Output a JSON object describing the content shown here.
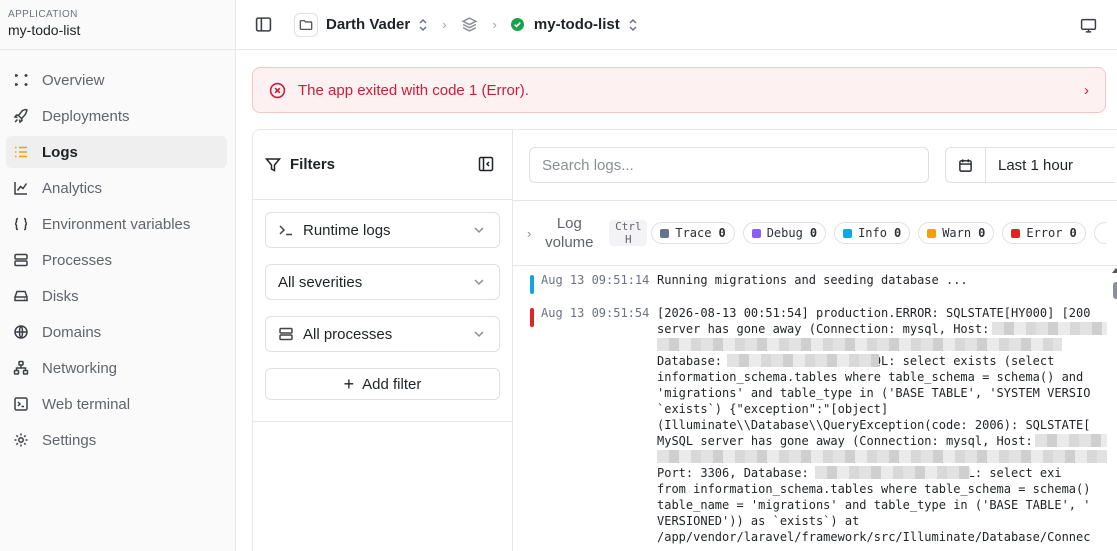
{
  "app": {
    "label": "APPLICATION",
    "name": "my-todo-list"
  },
  "nav": [
    {
      "label": "Overview",
      "icon": "eye-icon"
    },
    {
      "label": "Deployments",
      "icon": "rocket-icon"
    },
    {
      "label": "Logs",
      "icon": "list-icon",
      "active": true
    },
    {
      "label": "Analytics",
      "icon": "chart-line-icon"
    },
    {
      "label": "Environment variables",
      "icon": "braces-icon"
    },
    {
      "label": "Processes",
      "icon": "server-icon"
    },
    {
      "label": "Disks",
      "icon": "hard-drive-icon"
    },
    {
      "label": "Domains",
      "icon": "globe-icon"
    },
    {
      "label": "Networking",
      "icon": "network-icon"
    },
    {
      "label": "Web terminal",
      "icon": "terminal-icon"
    },
    {
      "label": "Settings",
      "icon": "gear-icon"
    }
  ],
  "breadcrumb": {
    "org": "Darth Vader",
    "app": "my-todo-list"
  },
  "banner": {
    "message": "The app exited with code 1 (Error)."
  },
  "filters": {
    "title": "Filters",
    "runtime": "Runtime logs",
    "severity": "All severities",
    "processes": "All processes",
    "add_filter": "Add filter"
  },
  "search": {
    "placeholder": "Search logs..."
  },
  "time": {
    "label": "Last 1 hour"
  },
  "volume": {
    "title_line1": "Log",
    "title_line2": "volume",
    "kbd_line1": "Ctrl",
    "kbd_line2": "H",
    "levels": [
      {
        "name": "Trace",
        "count": "0",
        "color": "#64748b"
      },
      {
        "name": "Debug",
        "count": "0",
        "color": "#8b5cf6"
      },
      {
        "name": "Info",
        "count": "0",
        "color": "#0ea5e9"
      },
      {
        "name": "Warn",
        "count": "0",
        "color": "#f59e0b"
      },
      {
        "name": "Error",
        "count": "0",
        "color": "#dc2626"
      }
    ]
  },
  "logs": [
    {
      "ts": "Aug 13 09:51:14",
      "color": "#0ea5e9",
      "lines": [
        "Running migrations and seeding database ..."
      ]
    },
    {
      "ts": "Aug 13 09:51:54",
      "color": "#dc2626",
      "lines": [
        "[2026-08-13 00:51:54] production.ERROR: SQLSTATE[HY000] [200",
        "server has gone away (Connection: mysql, Host: ",
        "                                               , P",
        "Database:                  , SQL: select exists (select",
        "information_schema.tables where table_schema = schema() and",
        "'migrations' and table_type in ('BASE TABLE', 'SYSTEM VERSIO",
        "`exists`) {\"exception\":\"[object]",
        "(Illuminate\\\\Database\\\\QueryException(code: 2006): SQLSTATE[",
        "MySQL server has gone away (Connection: mysql, Host: ",
        " ",
        "Port: 3306, Database:                    SQL: select exi",
        "from information_schema.tables where table_schema = schema()",
        "table_name = 'migrations' and table_type in ('BASE TABLE', '",
        "VERSIONED')) as `exists`) at",
        "/app/vendor/laravel/framework/src/Illuminate/Database/Connec"
      ]
    }
  ]
}
